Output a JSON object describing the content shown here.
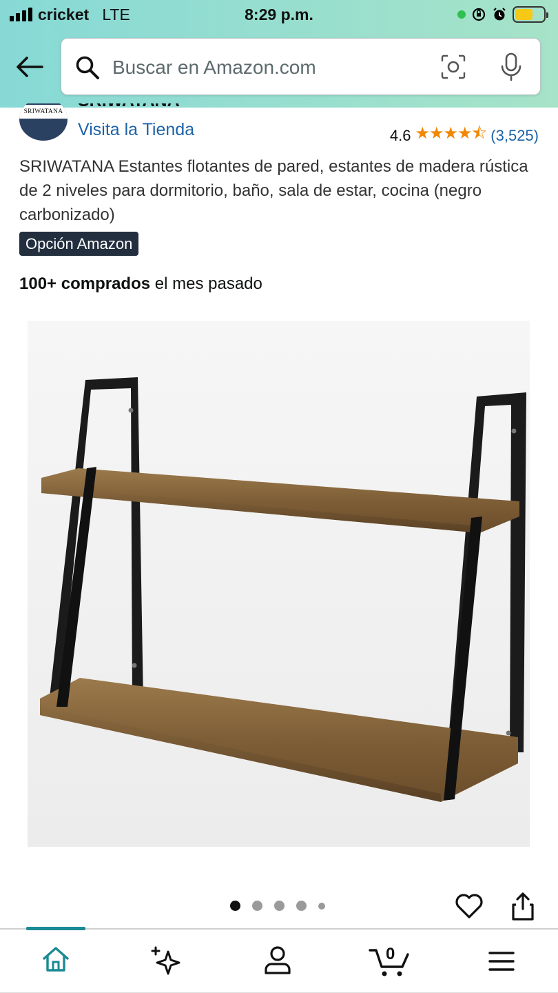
{
  "status_bar": {
    "carrier": "cricket",
    "network": "LTE",
    "time": "8:29 p.m."
  },
  "search": {
    "placeholder": "Buscar en Amazon.com"
  },
  "store": {
    "logo_text": "SRIWATANA",
    "brand_name": "SRIWATANA",
    "visit_label": "Visita la Tienda"
  },
  "rating": {
    "value": "4.6",
    "stars_glyphs": "★★★★⯪",
    "count": "(3,525)"
  },
  "product": {
    "title": "SRIWATANA Estantes flotantes de pared, estantes de madera rústica de 2 niveles para dormitorio, baño, sala de estar, cocina (negro carbonizado)",
    "badge": "Opción Amazon",
    "bought_strong": "100+ comprados",
    "bought_rest": " el mes pasado"
  },
  "gallery": {
    "image_count": 5,
    "active_index": 0
  },
  "nav": {
    "cart_count": "0",
    "active": "home"
  },
  "colors": {
    "header_start": "#87d9d6",
    "link": "#1d63a8",
    "star": "#f08804",
    "badge_bg": "#232f3e",
    "nav_accent": "#1a8a94"
  }
}
